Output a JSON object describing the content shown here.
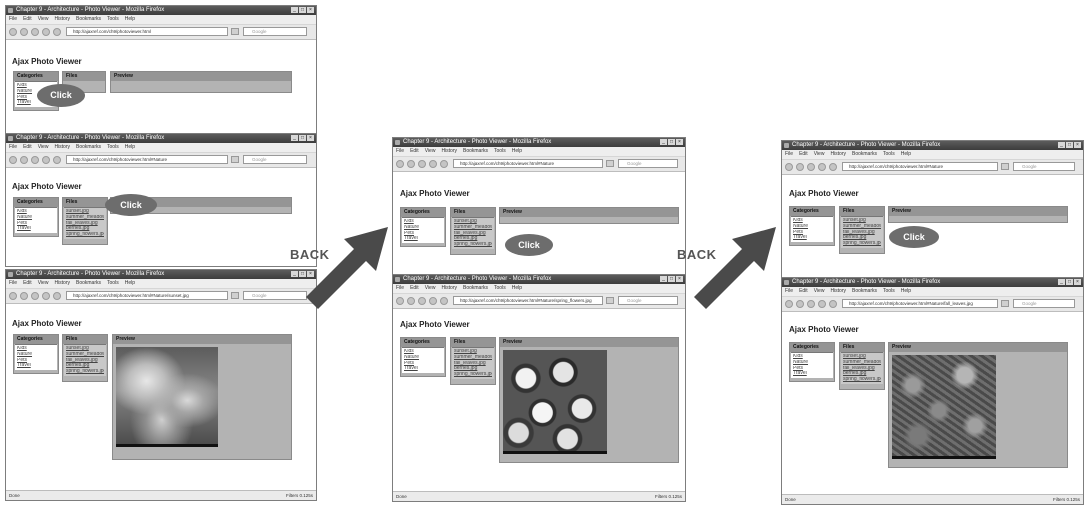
{
  "browser": {
    "window_title": "Chapter 9 - Architecture - Photo Viewer - Mozilla Firefox",
    "menu": [
      "File",
      "Edit",
      "View",
      "History",
      "Bookmarks",
      "Tools",
      "Help"
    ],
    "search_placeholder": "Google",
    "status_done": "Done",
    "status_right": "Filters  0.125s"
  },
  "app": {
    "title": "Ajax Photo Viewer",
    "headers": {
      "categories": "Categories",
      "files": "Files",
      "preview": "Preview"
    },
    "categories": [
      "Kids",
      "Nature",
      "Pets",
      "Travel"
    ],
    "files": [
      "sunset.jpg",
      "summer_meadow",
      "fall_leaves.jpg",
      "berries.jpg",
      "spring_flowers.jpg"
    ]
  },
  "screens": {
    "s1": {
      "url": "http://ajaxref.com/ch9/photoviewer.html"
    },
    "s2": {
      "url": "http://ajaxref.com/ch9/photoviewer.html#Nature"
    },
    "s3": {
      "url": "http://ajaxref.com/ch9/photoviewer.html#Nature/sunset.jpg"
    },
    "s4": {
      "url": "http://ajaxref.com/ch9/photoviewer.html#Nature"
    },
    "s5": {
      "url": "http://ajaxref.com/ch9/photoviewer.html#Nature/spring_flowers.jpg"
    },
    "s6": {
      "url": "http://ajaxref.com/ch9/photoviewer.html#Nature"
    },
    "s7": {
      "url": "http://ajaxref.com/ch9/photoviewer.html#Nature/fall_leaves.jpg"
    }
  },
  "annotations": {
    "click": "Click",
    "back": "BACK"
  }
}
